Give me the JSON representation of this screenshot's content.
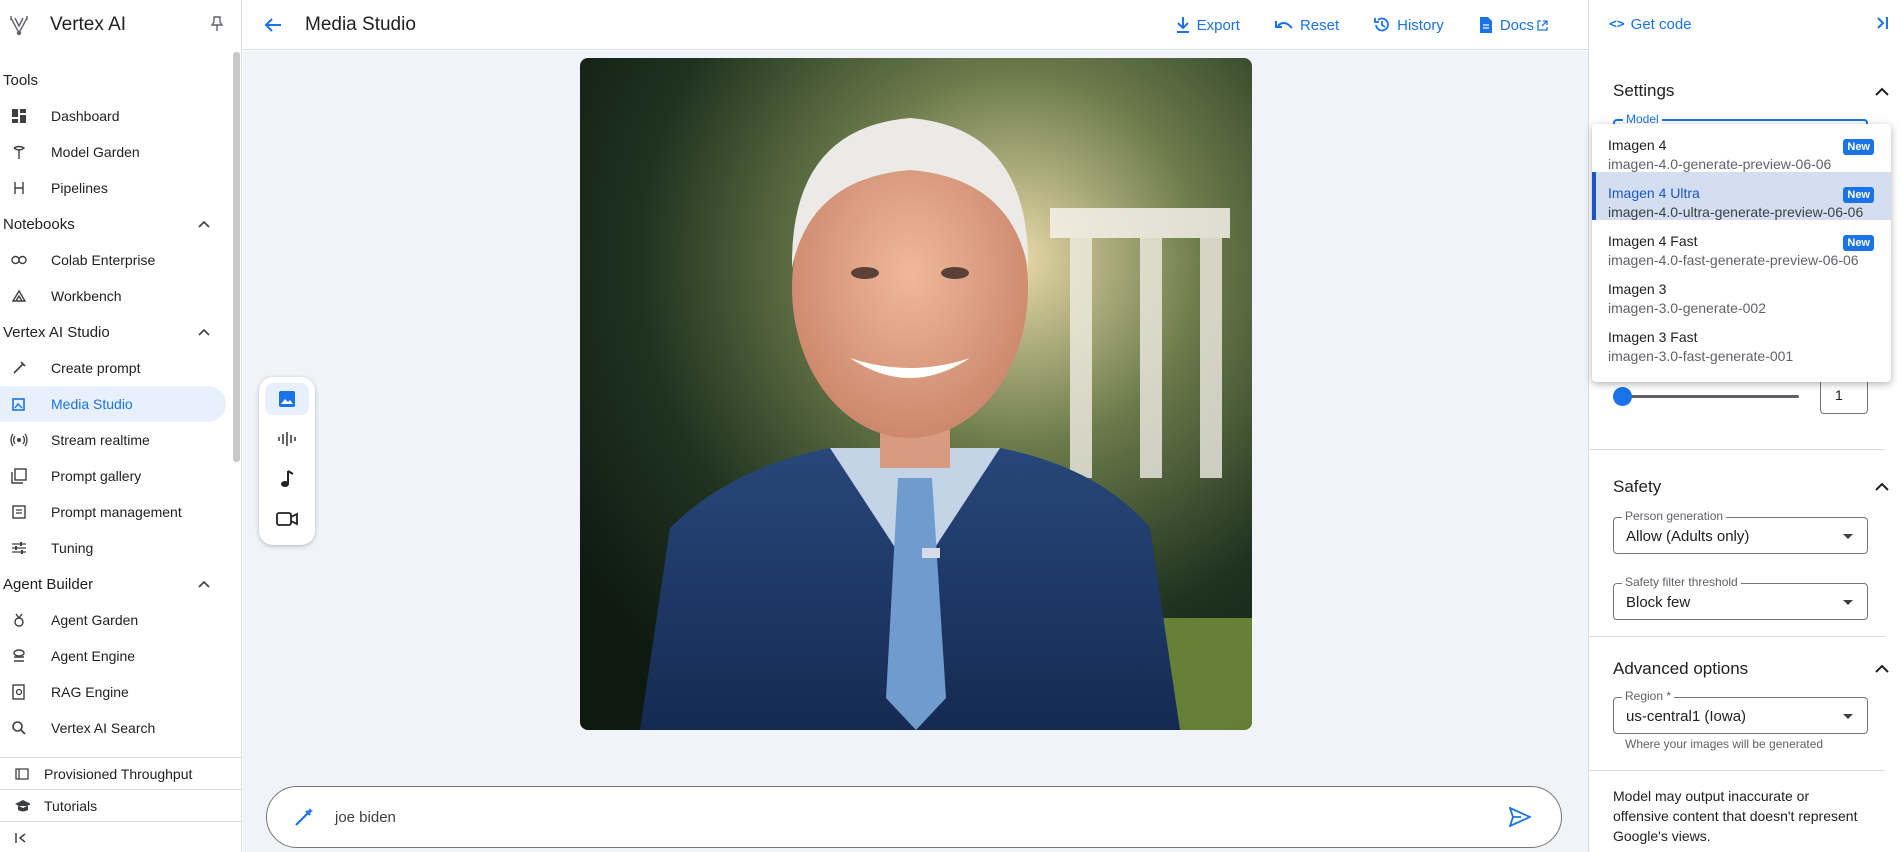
{
  "app": {
    "name": "Vertex AI"
  },
  "sidebar": {
    "sections": [
      {
        "title": "Tools",
        "items": [
          {
            "label": "Dashboard",
            "icon": "dashboard-icon"
          },
          {
            "label": "Model Garden",
            "icon": "model-garden-icon"
          },
          {
            "label": "Pipelines",
            "icon": "pipelines-icon"
          }
        ]
      },
      {
        "title": "Notebooks",
        "items": [
          {
            "label": "Colab Enterprise",
            "icon": "colab-icon"
          },
          {
            "label": "Workbench",
            "icon": "workbench-icon"
          }
        ]
      },
      {
        "title": "Vertex AI Studio",
        "items": [
          {
            "label": "Create prompt",
            "icon": "create-prompt-icon"
          },
          {
            "label": "Media Studio",
            "icon": "media-studio-icon",
            "active": true
          },
          {
            "label": "Stream realtime",
            "icon": "stream-icon"
          },
          {
            "label": "Prompt gallery",
            "icon": "prompt-gallery-icon"
          },
          {
            "label": "Prompt management",
            "icon": "prompt-management-icon"
          },
          {
            "label": "Tuning",
            "icon": "tuning-icon"
          }
        ]
      },
      {
        "title": "Agent Builder",
        "items": [
          {
            "label": "Agent Garden",
            "icon": "agent-garden-icon"
          },
          {
            "label": "Agent Engine",
            "icon": "agent-engine-icon"
          },
          {
            "label": "RAG Engine",
            "icon": "rag-engine-icon"
          },
          {
            "label": "Vertex AI Search",
            "icon": "search-icon"
          }
        ]
      }
    ],
    "bottom": [
      {
        "label": "Provisioned Throughput",
        "icon": "throughput-icon"
      },
      {
        "label": "Tutorials",
        "icon": "tutorials-icon"
      }
    ]
  },
  "topbar": {
    "title": "Media Studio",
    "actions": {
      "export": "Export",
      "reset": "Reset",
      "history": "History",
      "docs": "Docs"
    }
  },
  "prompt": {
    "value": "joe biden"
  },
  "right_panel": {
    "get_code": "Get code",
    "settings": {
      "title": "Settings",
      "model_label": "Model",
      "count_value": "1"
    },
    "safety": {
      "title": "Safety",
      "person_generation": {
        "label": "Person generation",
        "value": "Allow (Adults only)"
      },
      "safety_filter": {
        "label": "Safety filter threshold",
        "value": "Block few"
      }
    },
    "advanced": {
      "title": "Advanced options",
      "region": {
        "label": "Region *",
        "value": "us-central1 (Iowa)",
        "hint": "Where your images will be generated"
      }
    },
    "disclaimer": "Model may output inaccurate or offensive content that doesn't represent Google's views."
  },
  "model_dropdown": {
    "badge": "New",
    "options": [
      {
        "name": "Imagen 4",
        "id": "imagen-4.0-generate-preview-06-06",
        "new": true
      },
      {
        "name": "Imagen 4 Ultra",
        "id": "imagen-4.0-ultra-generate-preview-06-06",
        "new": true,
        "selected": true
      },
      {
        "name": "Imagen 4 Fast",
        "id": "imagen-4.0-fast-generate-preview-06-06",
        "new": true
      },
      {
        "name": "Imagen 3",
        "id": "imagen-3.0-generate-002",
        "new": false
      },
      {
        "name": "Imagen 3 Fast",
        "id": "imagen-3.0-fast-generate-001",
        "new": false
      }
    ]
  },
  "colors": {
    "accent": "#1a73e8",
    "canvas_bg": "#f0f4f9",
    "active_nav_bg": "#e8f0fe"
  }
}
